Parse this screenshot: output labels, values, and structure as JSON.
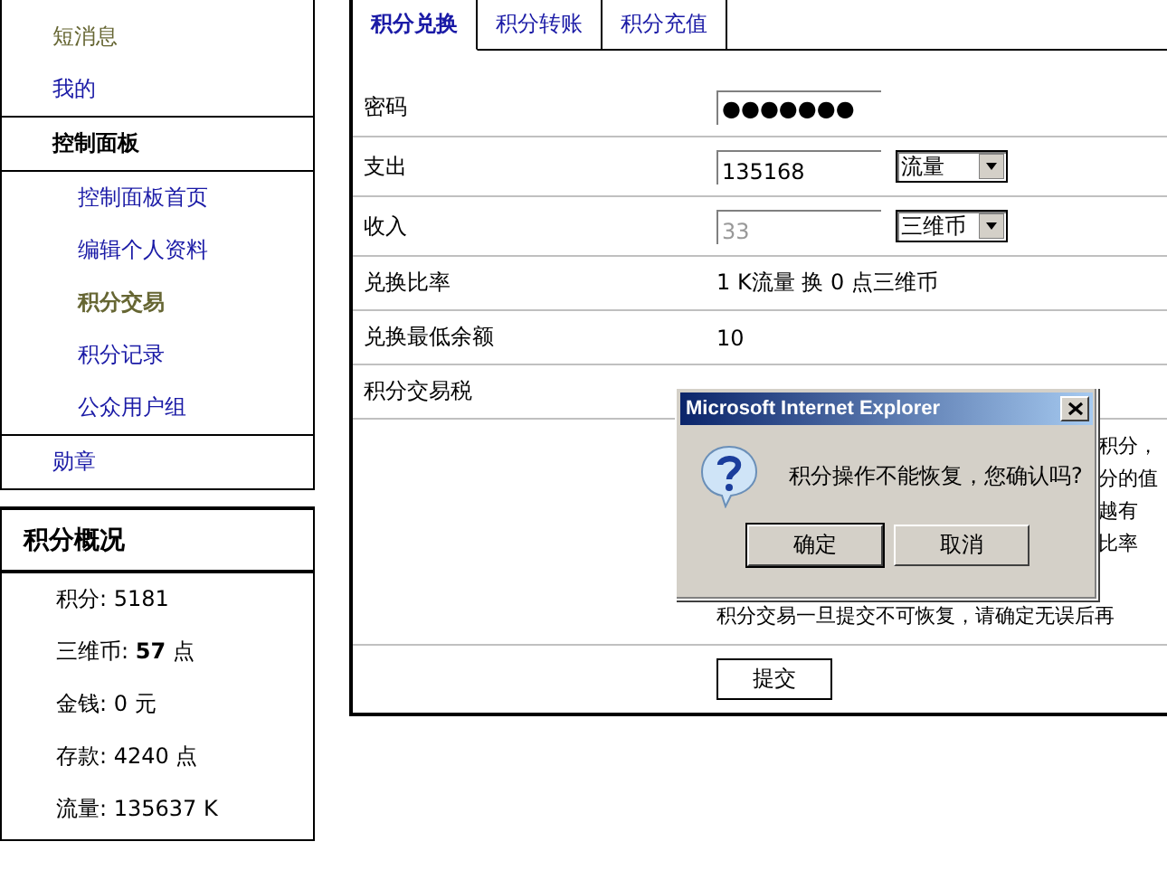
{
  "sidebar": {
    "menu": [
      {
        "label": "短消息",
        "kind": "link",
        "visited": true,
        "selected": false
      },
      {
        "label": "我的",
        "kind": "link",
        "visited": false,
        "selected": false
      },
      {
        "label": "控制面板",
        "kind": "header",
        "visited": false,
        "selected": false
      },
      {
        "label": "控制面板首页",
        "kind": "subitem",
        "visited": false,
        "selected": false
      },
      {
        "label": "编辑个人资料",
        "kind": "subitem",
        "visited": false,
        "selected": false
      },
      {
        "label": "积分交易",
        "kind": "subitem",
        "visited": false,
        "selected": true
      },
      {
        "label": "积分记录",
        "kind": "subitem",
        "visited": false,
        "selected": false
      },
      {
        "label": "公众用户组",
        "kind": "subitem",
        "visited": false,
        "selected": false
      },
      {
        "label": "勋章",
        "kind": "link",
        "visited": false,
        "selected": false
      }
    ],
    "overview": {
      "title": "积分概况",
      "items": [
        "积分: 5181",
        "三维币: **57** 点",
        "金钱: 0 元",
        "存款: 4240 点",
        "流量: 135637 K"
      ]
    }
  },
  "tabs": [
    {
      "label": "积分兑换",
      "selected": true
    },
    {
      "label": "积分转账",
      "selected": false
    },
    {
      "label": "积分充值",
      "selected": false
    }
  ],
  "form": {
    "rows": [
      {
        "label": "密码",
        "kind": "password",
        "value": "●●●●●●●"
      },
      {
        "label": "支出",
        "kind": "amount",
        "value": "135168",
        "disabled": false,
        "unit": "流量"
      },
      {
        "label": "收入",
        "kind": "amount",
        "value": "33",
        "disabled": true,
        "unit": "三维币"
      },
      {
        "label": "兑换比率",
        "kind": "text",
        "value": "1 K流量 换 0 点三维币"
      },
      {
        "label": "兑换最低余额",
        "kind": "text",
        "value": "10"
      },
      {
        "label": "积分交易税",
        "kind": "text"
      }
    ],
    "notes": [
      "积分，",
      "分的值",
      "越有",
      "比率"
    ],
    "warning": "积分交易一旦提交不可恢复，请确定无误后再",
    "submit": "提交"
  },
  "dialog": {
    "title": "Microsoft Internet Explorer",
    "message": "积分操作不能恢复，您确认吗?",
    "buttons": [
      {
        "label": "确定",
        "selected": true
      },
      {
        "label": "取消",
        "selected": false
      }
    ]
  }
}
